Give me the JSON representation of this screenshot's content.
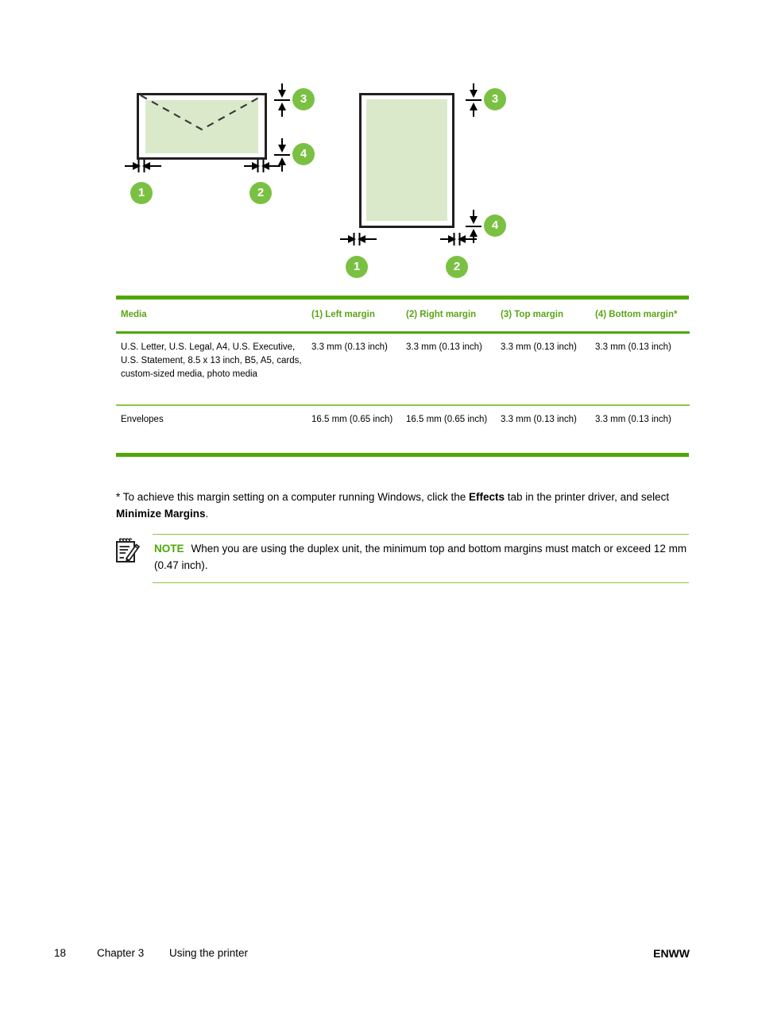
{
  "diagram": {
    "envelope": {
      "name": "envelope-margin-diagram",
      "badges": [
        {
          "id": "1",
          "label": "1",
          "meaning": "left-margin"
        },
        {
          "id": "2",
          "label": "2",
          "meaning": "right-margin"
        },
        {
          "id": "3",
          "label": "3",
          "meaning": "top-margin"
        },
        {
          "id": "4",
          "label": "4",
          "meaning": "bottom-margin"
        }
      ]
    },
    "page": {
      "name": "paper-margin-diagram",
      "badges": [
        {
          "id": "1",
          "label": "1",
          "meaning": "left-margin"
        },
        {
          "id": "2",
          "label": "2",
          "meaning": "right-margin"
        },
        {
          "id": "3",
          "label": "3",
          "meaning": "top-margin"
        },
        {
          "id": "4",
          "label": "4",
          "meaning": "bottom-margin"
        }
      ]
    },
    "colors": {
      "badge": "#7ac143",
      "media_fill": "#dbe9cb",
      "outline": "#231f20"
    }
  },
  "table": {
    "headers": [
      "Media",
      "(1) Left margin",
      "(2) Right margin",
      "(3) Top margin",
      "(4) Bottom margin*"
    ],
    "rows": [
      {
        "media": "U.S. Letter, U.S. Legal, A4, U.S. Executive, U.S. Statement, 8.5 x 13 inch, B5, A5, cards, custom-sized media, photo media",
        "left": "3.3 mm (0.13 inch)",
        "right": "3.3 mm (0.13 inch)",
        "top": "3.3 mm (0.13 inch)",
        "bottom": "3.3 mm (0.13 inch)"
      },
      {
        "media": "Envelopes",
        "left": "16.5 mm (0.65 inch)",
        "right": "16.5 mm (0.65 inch)",
        "top": "3.3 mm (0.13 inch)",
        "bottom": "3.3 mm (0.13 inch)"
      }
    ],
    "accent_color": "#4fa806",
    "header_text_color": "#5aa515"
  },
  "footnote": {
    "part1": "* To achieve this margin setting on a computer running Windows, click the ",
    "bold1": "Effects",
    "part2": " tab in the printer driver, and select ",
    "bold2": "Minimize Margins",
    "part3": "."
  },
  "note": {
    "icon": "note-pencil-icon",
    "label": "NOTE",
    "text": "When you are using the duplex unit, the minimum top and bottom margins must match or exceed 12 mm (0.47 inch).",
    "label_color": "#4fa806"
  },
  "footer": {
    "page_number": "18",
    "chapter": "Chapter 3",
    "section": "Using the printer",
    "locale": "ENWW"
  }
}
